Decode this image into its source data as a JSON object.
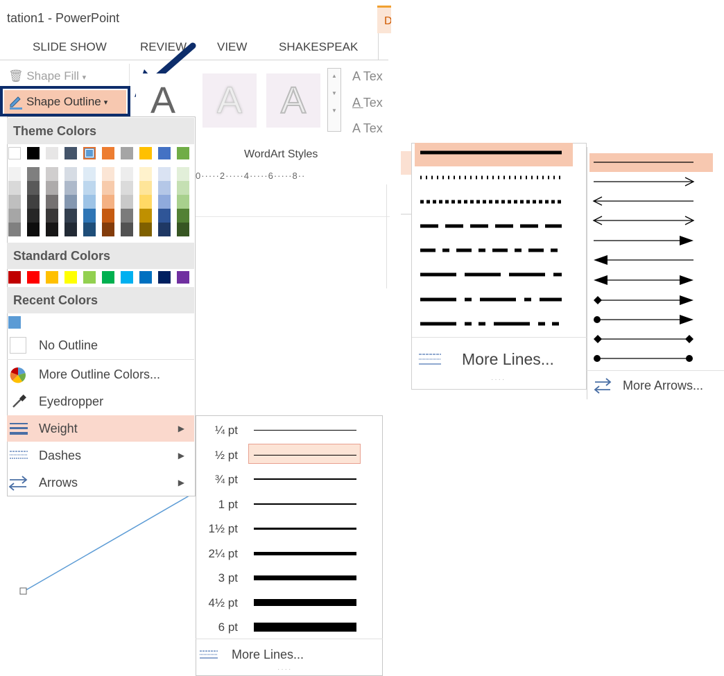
{
  "window": {
    "title": "tation1 - PowerPoint",
    "context_tab_letter": "D"
  },
  "tabs": [
    {
      "label": "SLIDE SHOW"
    },
    {
      "label": "REVIEW"
    },
    {
      "label": "VIEW"
    },
    {
      "label": "SHAKESPEAK"
    }
  ],
  "ribbon": {
    "shape_fill": "Shape Fill",
    "shape_outline": "Shape Outline",
    "wordart_letter": "A",
    "wordart_styles": "WordArt Styles",
    "text_items": [
      "Tex",
      "Tex",
      "Tex"
    ],
    "ruler_text": "0·····2·····4·····6·····8··"
  },
  "outline_menu": {
    "theme_colors_header": "Theme Colors",
    "theme_colors_top": [
      "#ffffff",
      "#000000",
      "#e7e6e6",
      "#44546a",
      "#5b9bd5",
      "#ed7d31",
      "#a5a5a5",
      "#ffc000",
      "#4472c4",
      "#70ad47"
    ],
    "theme_color_shades": [
      [
        "#f2f2f2",
        "#d9d9d9",
        "#bfbfbf",
        "#a6a6a6",
        "#808080"
      ],
      [
        "#7f7f7f",
        "#595959",
        "#404040",
        "#262626",
        "#0d0d0d"
      ],
      [
        "#d0cece",
        "#aeabab",
        "#757171",
        "#3a3838",
        "#171616"
      ],
      [
        "#d6dce4",
        "#adb9ca",
        "#8497b0",
        "#333f4f",
        "#222a35"
      ],
      [
        "#deebf6",
        "#bdd7ee",
        "#9dc3e6",
        "#2e75b5",
        "#1f4e79"
      ],
      [
        "#fbe5d5",
        "#f7cbac",
        "#f4b183",
        "#c55a11",
        "#833c0b"
      ],
      [
        "#ededed",
        "#dbdbdb",
        "#c9c9c9",
        "#7b7b7b",
        "#525252"
      ],
      [
        "#fff2cc",
        "#fee599",
        "#ffd965",
        "#bf9000",
        "#7f6000"
      ],
      [
        "#dae3f3",
        "#b4c7e7",
        "#8faadc",
        "#2f5597",
        "#1f3864"
      ],
      [
        "#e2efd9",
        "#c5e0b3",
        "#a8d08d",
        "#538135",
        "#375623"
      ]
    ],
    "standard_colors_header": "Standard Colors",
    "standard_colors": [
      "#c00000",
      "#ff0000",
      "#ffc000",
      "#ffff00",
      "#92d050",
      "#00b050",
      "#00b0f0",
      "#0070c0",
      "#002060",
      "#7030a0"
    ],
    "recent_colors_header": "Recent Colors",
    "recent_colors": [
      "#5b9bd5"
    ],
    "no_outline": "No Outline",
    "more_outline_colors": "More Outline Colors...",
    "eyedropper": "Eyedropper",
    "weight": "Weight",
    "dashes": "Dashes",
    "arrows": "Arrows"
  },
  "weight_menu": {
    "items": [
      {
        "label": "¼ pt",
        "pt": 0.25
      },
      {
        "label": "½ pt",
        "pt": 0.5
      },
      {
        "label": "¾ pt",
        "pt": 0.75
      },
      {
        "label": "1 pt",
        "pt": 1
      },
      {
        "label": "1½ pt",
        "pt": 1.5
      },
      {
        "label": "2¼ pt",
        "pt": 2.25
      },
      {
        "label": "3 pt",
        "pt": 3
      },
      {
        "label": "4½ pt",
        "pt": 4.5
      },
      {
        "label": "6 pt",
        "pt": 6
      }
    ],
    "selected": "½ pt",
    "more_lines": "More Lines..."
  },
  "dashes_menu": {
    "styles": [
      "solid",
      "round-dot",
      "square-dot",
      "dash",
      "dash-dot",
      "long-dash",
      "long-dash-dot",
      "long-dash-dot-dot"
    ],
    "more_lines": "More Lines..."
  },
  "arrows_menu": {
    "styles": [
      "none",
      "open-end",
      "open-start",
      "open-both",
      "triangle-end",
      "triangle-start",
      "triangle-both",
      "diamond-start-triangle-end",
      "oval-start-triangle-end",
      "diamond-both",
      "oval-both"
    ],
    "more_arrows": "More Arrows..."
  },
  "colors": {
    "highlight": "#fad8cc",
    "callout": "#0d2d6b"
  }
}
